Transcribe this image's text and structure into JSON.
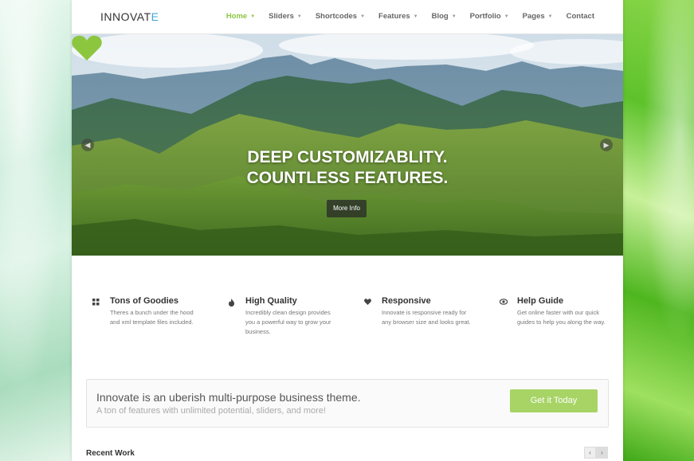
{
  "brand": {
    "name_main": "INNOVAT",
    "name_accent": "E",
    "accent_color": "#3fa8d8"
  },
  "nav": {
    "items": [
      {
        "label": "Home",
        "active": true,
        "has_dropdown": true
      },
      {
        "label": "Sliders",
        "has_dropdown": true
      },
      {
        "label": "Shortcodes",
        "has_dropdown": true
      },
      {
        "label": "Features",
        "has_dropdown": true
      },
      {
        "label": "Blog",
        "has_dropdown": true
      },
      {
        "label": "Portfolio",
        "has_dropdown": true
      },
      {
        "label": "Pages",
        "has_dropdown": true
      },
      {
        "label": "Contact",
        "has_dropdown": false
      }
    ],
    "active_color": "#8cc63f"
  },
  "hero": {
    "icon": "heart-icon",
    "icon_color": "#8cc63f",
    "title_line1": "DEEP CUSTOMIZABLITY.",
    "title_line2": "COUNTLESS FEATURES.",
    "button_label": "More Info"
  },
  "features": [
    {
      "icon": "grid-icon",
      "title": "Tons of Goodies",
      "desc": "Theres a bunch under the hood and xml template files included."
    },
    {
      "icon": "fire-icon",
      "title": "High Quality",
      "desc": "Incredibly clean design provides you a powerful way to grow your business."
    },
    {
      "icon": "heart-icon",
      "title": "Responsive",
      "desc": "Innovate is responsive ready for any browser size and looks great."
    },
    {
      "icon": "eye-icon",
      "title": "Help Guide",
      "desc": "Get online faster with our quick guides to help you along the way."
    }
  ],
  "callout": {
    "title": "Innovate is an uberish multi-purpose business theme.",
    "subtitle": "A ton of features with unlimited potential, sliders, and more!",
    "button_label": "Get it Today",
    "button_color": "#a7d465"
  },
  "recent_work": {
    "title": "Recent Work",
    "prev_icon": "chevron-left-icon",
    "next_icon": "chevron-right-icon"
  }
}
